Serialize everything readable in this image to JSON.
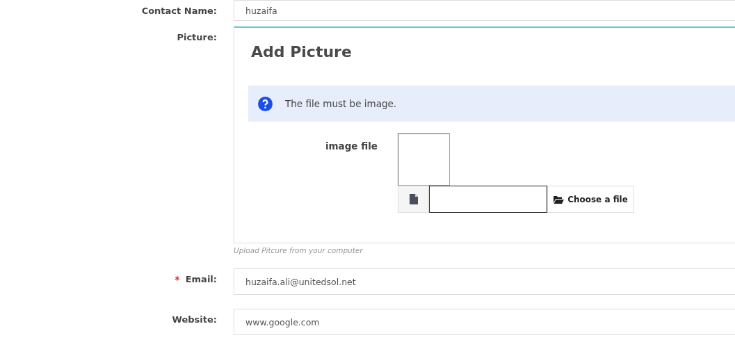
{
  "fields": [
    {
      "kind": "text",
      "label": "Contact Name:",
      "value": "huzaifa"
    },
    {
      "kind": "picture",
      "label": "Picture:",
      "panel": {
        "title": "Add Picture",
        "info": "The file must be image.",
        "file_label": "image file",
        "button": "Choose a file"
      },
      "help": "Upload Pitcure from your computer"
    },
    {
      "kind": "text",
      "label": "Email:",
      "required_mark": "*",
      "value": "huzaifa.ali@unitedsol.net"
    },
    {
      "kind": "text",
      "label": "Website:",
      "value": "www.google.com"
    }
  ]
}
